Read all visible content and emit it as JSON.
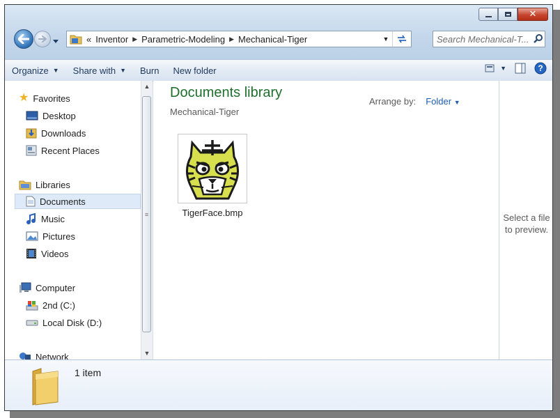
{
  "window": {
    "caption_buttons": {
      "minimize": "minimize-icon",
      "maximize": "maximize-icon",
      "close": "close-icon"
    }
  },
  "address": {
    "overflow_chevron": "«",
    "crumbs": [
      "Inventor",
      "Parametric-Modeling",
      "Mechanical-Tiger"
    ]
  },
  "search": {
    "placeholder": "Search Mechanical-T..."
  },
  "toolbar": {
    "organize": "Organize",
    "share_with": "Share with",
    "burn": "Burn",
    "new_folder": "New folder"
  },
  "nav": {
    "favorites": "Favorites",
    "desktop": "Desktop",
    "downloads": "Downloads",
    "recent_places": "Recent Places",
    "libraries": "Libraries",
    "documents": "Documents",
    "music": "Music",
    "pictures": "Pictures",
    "videos": "Videos",
    "computer": "Computer",
    "drive_c": "2nd (C:)",
    "drive_d": "Local Disk (D:)",
    "network": "Network"
  },
  "content": {
    "library_title": "Documents library",
    "library_subtitle": "Mechanical-Tiger",
    "arrange_label": "Arrange by:",
    "arrange_value": "Folder",
    "files": [
      {
        "name": "TigerFace.bmp"
      }
    ]
  },
  "preview": {
    "line1": "Select a file",
    "line2": "to preview."
  },
  "details": {
    "count": "1 item"
  },
  "colors": {
    "library_title": "#1e6f2c",
    "link": "#1e5cb3",
    "tiger_yellow": "#d8df4f",
    "close_red": "#c6452f"
  }
}
